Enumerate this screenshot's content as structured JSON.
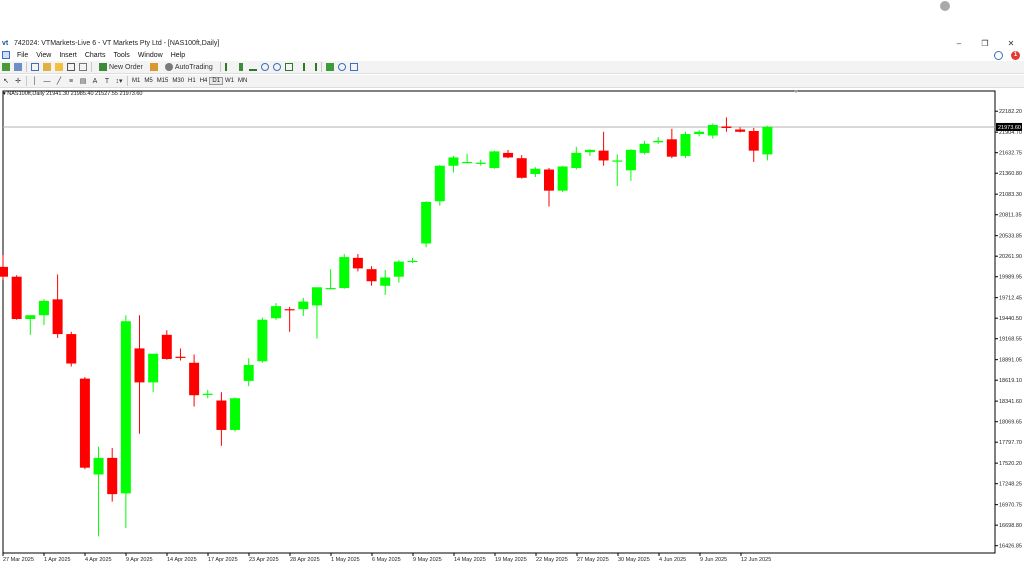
{
  "window": {
    "title": "742024: VTMarkets-Live 6 - VT Markets Pty Ltd - [NAS100ft,Daily]",
    "minimize": "–",
    "restore": "❐",
    "close": "✕"
  },
  "menu": {
    "items": [
      "File",
      "View",
      "Insert",
      "Charts",
      "Tools",
      "Window",
      "Help"
    ],
    "alert_count": "1"
  },
  "toolbar": {
    "new_order": "New Order",
    "autotrading": "AutoTrading"
  },
  "timeframes": [
    "M1",
    "M5",
    "M15",
    "M30",
    "H1",
    "H4",
    "D1",
    "W1",
    "MN"
  ],
  "chart_header": "NAS100ft,Daily  21941.30 21985.40 21527.55 21973.60",
  "current_price": "21973.60",
  "chart_data": {
    "type": "candlestick",
    "symbol": "NAS100ft",
    "timeframe": "Daily",
    "ylim": [
      16330,
      22450
    ],
    "y_ticks": [
      "22182.20",
      "21904.70",
      "21632.75",
      "21360.80",
      "21083.30",
      "20811.35",
      "20533.85",
      "20261.90",
      "19989.95",
      "19712.45",
      "19440.50",
      "19168.55",
      "18891.05",
      "18619.10",
      "18341.60",
      "18069.65",
      "17797.70",
      "17520.20",
      "17248.25",
      "16970.75",
      "16698.80",
      "16426.85"
    ],
    "x_ticks": [
      "27 Mar 2025",
      "1 Apr 2025",
      "4 Apr 2025",
      "9 Apr 2025",
      "14 Apr 2025",
      "17 Apr 2025",
      "23 Apr 2025",
      "28 Apr 2025",
      "1 May 2025",
      "6 May 2025",
      "9 May 2025",
      "14 May 2025",
      "19 May 2025",
      "22 May 2025",
      "27 May 2025",
      "30 May 2025",
      "4 Jun 2025",
      "9 Jun 2025",
      "12 Jun 2025"
    ],
    "colors": {
      "bull": "#00ff00",
      "bear": "#ff0000",
      "grid": "#b0b0b0"
    },
    "candles": [
      {
        "o": 20120,
        "h": 20280,
        "l": 19950,
        "c": 19990
      },
      {
        "o": 19990,
        "h": 20010,
        "l": 19420,
        "c": 19430
      },
      {
        "o": 19430,
        "h": 19460,
        "l": 19220,
        "c": 19480
      },
      {
        "o": 19480,
        "h": 19690,
        "l": 19350,
        "c": 19670
      },
      {
        "o": 19690,
        "h": 20020,
        "l": 19180,
        "c": 19230
      },
      {
        "o": 19230,
        "h": 19260,
        "l": 18800,
        "c": 18840
      },
      {
        "o": 18640,
        "h": 18660,
        "l": 17440,
        "c": 17460
      },
      {
        "o": 17370,
        "h": 17740,
        "l": 16550,
        "c": 17590
      },
      {
        "o": 17590,
        "h": 17720,
        "l": 17010,
        "c": 17110
      },
      {
        "o": 17120,
        "h": 19480,
        "l": 16660,
        "c": 19400
      },
      {
        "o": 19040,
        "h": 19480,
        "l": 17910,
        "c": 18590
      },
      {
        "o": 18590,
        "h": 18920,
        "l": 18460,
        "c": 18970
      },
      {
        "o": 19220,
        "h": 19280,
        "l": 18890,
        "c": 18900
      },
      {
        "o": 18930,
        "h": 19040,
        "l": 18880,
        "c": 18920
      },
      {
        "o": 18850,
        "h": 18960,
        "l": 18270,
        "c": 18420
      },
      {
        "o": 18430,
        "h": 18490,
        "l": 18380,
        "c": 18440
      },
      {
        "o": 18350,
        "h": 18460,
        "l": 17750,
        "c": 17960
      },
      {
        "o": 17960,
        "h": 18390,
        "l": 17940,
        "c": 18380
      },
      {
        "o": 18610,
        "h": 18910,
        "l": 18540,
        "c": 18820
      },
      {
        "o": 18870,
        "h": 19450,
        "l": 18850,
        "c": 19420
      },
      {
        "o": 19440,
        "h": 19640,
        "l": 19420,
        "c": 19600
      },
      {
        "o": 19560,
        "h": 19590,
        "l": 19260,
        "c": 19550
      },
      {
        "o": 19560,
        "h": 19710,
        "l": 19470,
        "c": 19660
      },
      {
        "o": 19610,
        "h": 19750,
        "l": 19170,
        "c": 19850
      },
      {
        "o": 19840,
        "h": 20090,
        "l": 19820,
        "c": 19840
      },
      {
        "o": 19840,
        "h": 20290,
        "l": 19830,
        "c": 20250
      },
      {
        "o": 20240,
        "h": 20290,
        "l": 20060,
        "c": 20100
      },
      {
        "o": 20090,
        "h": 20130,
        "l": 19870,
        "c": 19930
      },
      {
        "o": 19870,
        "h": 20080,
        "l": 19750,
        "c": 19980
      },
      {
        "o": 19990,
        "h": 20210,
        "l": 19910,
        "c": 20190
      },
      {
        "o": 20200,
        "h": 20240,
        "l": 20170,
        "c": 20200
      },
      {
        "o": 20430,
        "h": 20990,
        "l": 20380,
        "c": 20980
      },
      {
        "o": 20990,
        "h": 21470,
        "l": 20930,
        "c": 21460
      },
      {
        "o": 21460,
        "h": 21590,
        "l": 21370,
        "c": 21570
      },
      {
        "o": 21510,
        "h": 21620,
        "l": 21490,
        "c": 21510
      },
      {
        "o": 21490,
        "h": 21540,
        "l": 21460,
        "c": 21500
      },
      {
        "o": 21430,
        "h": 21660,
        "l": 21420,
        "c": 21650
      },
      {
        "o": 21630,
        "h": 21670,
        "l": 21560,
        "c": 21570
      },
      {
        "o": 21560,
        "h": 21600,
        "l": 21290,
        "c": 21300
      },
      {
        "o": 21350,
        "h": 21440,
        "l": 21310,
        "c": 21420
      },
      {
        "o": 21410,
        "h": 21430,
        "l": 20920,
        "c": 21130
      },
      {
        "o": 21130,
        "h": 21460,
        "l": 21110,
        "c": 21450
      },
      {
        "o": 21430,
        "h": 21710,
        "l": 21410,
        "c": 21630
      },
      {
        "o": 21640,
        "h": 21680,
        "l": 21590,
        "c": 21670
      },
      {
        "o": 21660,
        "h": 21910,
        "l": 21460,
        "c": 21530
      },
      {
        "o": 21530,
        "h": 21610,
        "l": 21190,
        "c": 21530
      },
      {
        "o": 21400,
        "h": 21680,
        "l": 21260,
        "c": 21670
      },
      {
        "o": 21630,
        "h": 21790,
        "l": 21610,
        "c": 21750
      },
      {
        "o": 21770,
        "h": 21840,
        "l": 21750,
        "c": 21790
      },
      {
        "o": 21810,
        "h": 21950,
        "l": 21560,
        "c": 21580
      },
      {
        "o": 21590,
        "h": 21910,
        "l": 21560,
        "c": 21880
      },
      {
        "o": 21880,
        "h": 21930,
        "l": 21850,
        "c": 21910
      },
      {
        "o": 21860,
        "h": 22020,
        "l": 21820,
        "c": 22000
      },
      {
        "o": 21980,
        "h": 22100,
        "l": 21910,
        "c": 21960
      },
      {
        "o": 21940,
        "h": 21970,
        "l": 21900,
        "c": 21910
      },
      {
        "o": 21920,
        "h": 21960,
        "l": 21510,
        "c": 21660
      },
      {
        "o": 21610,
        "h": 21990,
        "l": 21530,
        "c": 21975
      }
    ]
  }
}
